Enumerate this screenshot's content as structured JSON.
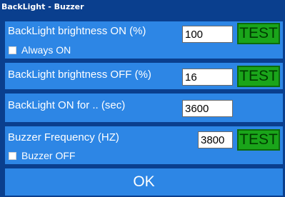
{
  "window": {
    "title": "BackLight - Buzzer"
  },
  "backlight_on": {
    "label": "BackLight brightness ON  (%)",
    "value": "100",
    "test_label": "TEST",
    "always_on_label": "Always ON",
    "always_on_checked": false
  },
  "backlight_off": {
    "label": "BackLight brightness OFF (%)",
    "value": "16",
    "test_label": "TEST"
  },
  "backlight_time": {
    "label": "BackLight ON for .. (sec)",
    "value": "3600"
  },
  "buzzer": {
    "label": "Buzzer Frequency (HZ)",
    "value": "3800",
    "test_label": "TEST",
    "off_label": "Buzzer OFF",
    "off_checked": false
  },
  "ok_label": "OK",
  "colors": {
    "background": "#0a3f8e",
    "panel": "#2d86e5",
    "test_button": "#1aa51a",
    "text": "#ffffff"
  }
}
